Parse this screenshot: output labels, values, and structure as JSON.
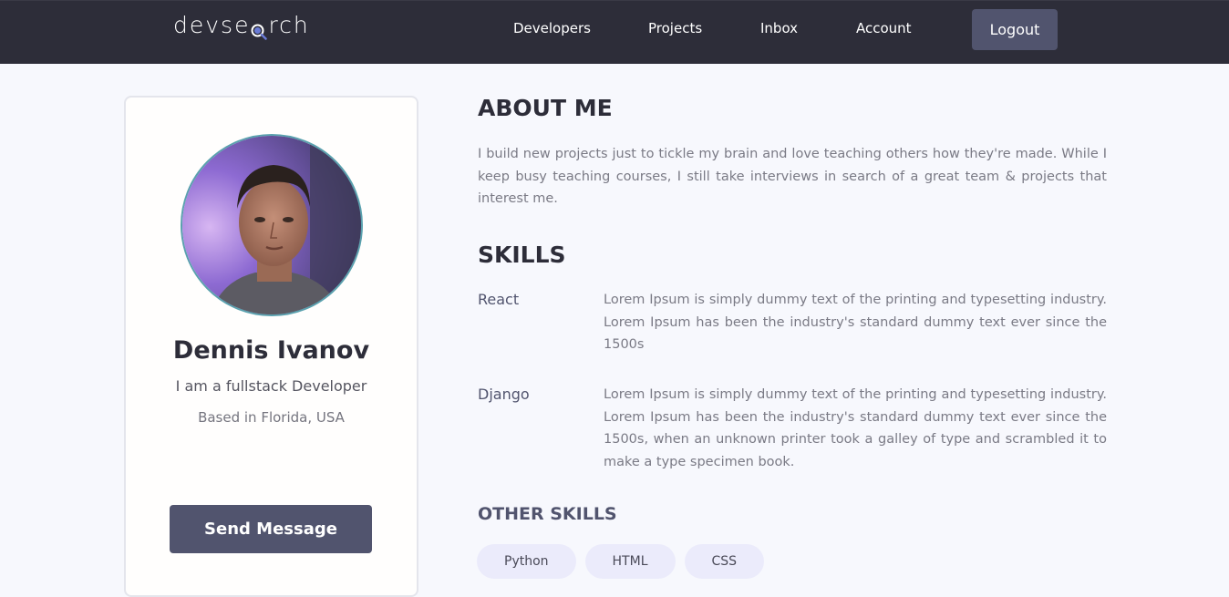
{
  "header": {
    "logo_text_before": "devse",
    "logo_text_after": "rch",
    "nav": [
      {
        "label": "Developers"
      },
      {
        "label": "Projects"
      },
      {
        "label": "Inbox"
      },
      {
        "label": "Account"
      }
    ],
    "logout_label": "Logout"
  },
  "profile": {
    "name": "Dennis Ivanov",
    "tagline": "I am a fullstack Developer",
    "location": "Based in Florida, USA",
    "send_label": "Send Message"
  },
  "about": {
    "title": "ABOUT ME",
    "text": "I build new projects just to tickle my brain and love teaching others how they're made. While I keep busy teaching courses, I still take interviews in search of a great team & projects that interest me."
  },
  "skills": {
    "title": "SKILLS",
    "items": [
      {
        "name": "React",
        "description": "Lorem Ipsum is simply dummy text of the printing and typesetting industry. Lorem Ipsum has been the industry's standard dummy text ever since the 1500s"
      },
      {
        "name": "Django",
        "description": "Lorem Ipsum is simply dummy text of the printing and typesetting industry. Lorem Ipsum has been the industry's standard dummy text ever since the 1500s, when an unknown printer took a galley of type and scrambled it to make a type specimen book."
      }
    ]
  },
  "other_skills": {
    "title": "OTHER SKILLS",
    "tags": [
      "Python",
      "HTML",
      "CSS"
    ]
  },
  "colors": {
    "header_bg": "#2d2d39",
    "accent": "#51546e",
    "page_bg": "#f7f8fd",
    "tag_bg": "#ebebfb"
  }
}
